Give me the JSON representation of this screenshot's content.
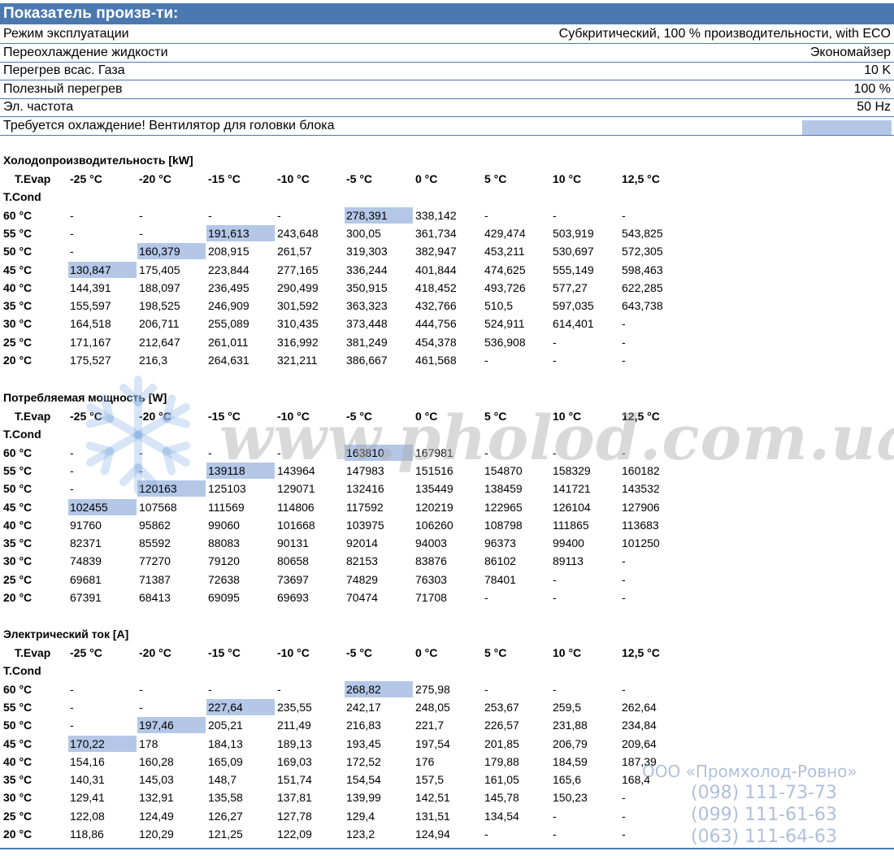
{
  "header": {
    "title": "Показатель произв-ти:"
  },
  "info_rows": [
    {
      "label": "Режим эксплуатации",
      "value": "Субкритический, 100 % производительности, with ECO"
    },
    {
      "label": "Переохлаждение жидкости",
      "value": "Экономайзер"
    },
    {
      "label": "Перегрев всас. Газа",
      "value": "10 K"
    },
    {
      "label": "Полезный перегрев",
      "value": "100 %"
    },
    {
      "label": "Эл. частота",
      "value": "50 Hz"
    },
    {
      "label": "Требуется охлаждение! Вентилятор для головки блока",
      "value": ""
    }
  ],
  "colors": {
    "header": "#4a79b0",
    "highlight": "#b4c7e7"
  },
  "tables": [
    {
      "title": "Холодопроизводительность [kW]",
      "evap_label": "T.Evap",
      "cond_label": "T.Cond",
      "columns": [
        "-25 °C",
        "-20 °C",
        "-15 °C",
        "-10 °C",
        "-5 °C",
        "0 °C",
        "5 °C",
        "10 °C",
        "12,5 °C"
      ],
      "rows": [
        {
          "cond": "60 °C",
          "cells": [
            "-",
            "-",
            "-",
            "-",
            "278,391",
            "338,142",
            "-",
            "-",
            "-"
          ],
          "highlight": 4
        },
        {
          "cond": "55 °C",
          "cells": [
            "-",
            "-",
            "191,613",
            "243,648",
            "300,05",
            "361,734",
            "429,474",
            "503,919",
            "543,825"
          ],
          "highlight": 2
        },
        {
          "cond": "50 °C",
          "cells": [
            "-",
            "160,379",
            "208,915",
            "261,57",
            "319,303",
            "382,947",
            "453,211",
            "530,697",
            "572,305"
          ],
          "highlight": 1
        },
        {
          "cond": "45 °C",
          "cells": [
            "130,847",
            "175,405",
            "223,844",
            "277,165",
            "336,244",
            "401,844",
            "474,625",
            "555,149",
            "598,463"
          ],
          "highlight": 0
        },
        {
          "cond": "40 °C",
          "cells": [
            "144,391",
            "188,097",
            "236,495",
            "290,499",
            "350,915",
            "418,452",
            "493,726",
            "577,27",
            "622,285"
          ]
        },
        {
          "cond": "35 °C",
          "cells": [
            "155,597",
            "198,525",
            "246,909",
            "301,592",
            "363,323",
            "432,766",
            "510,5",
            "597,035",
            "643,738"
          ]
        },
        {
          "cond": "30 °C",
          "cells": [
            "164,518",
            "206,711",
            "255,089",
            "310,435",
            "373,448",
            "444,756",
            "524,911",
            "614,401",
            "-"
          ]
        },
        {
          "cond": "25 °C",
          "cells": [
            "171,167",
            "212,647",
            "261,011",
            "316,992",
            "381,249",
            "454,378",
            "536,908",
            "-",
            "-"
          ]
        },
        {
          "cond": "20 °C",
          "cells": [
            "175,527",
            "216,3",
            "264,631",
            "321,211",
            "386,667",
            "461,568",
            "-",
            "-",
            "-"
          ]
        }
      ]
    },
    {
      "title": "Потребляемая мощность [W]",
      "evap_label": "T.Evap",
      "cond_label": "T.Cond",
      "columns": [
        "-25 °C",
        "-20 °C",
        "-15 °C",
        "-10 °C",
        "-5 °C",
        "0 °C",
        "5 °C",
        "10 °C",
        "12,5 °C"
      ],
      "rows": [
        {
          "cond": "60 °C",
          "cells": [
            "-",
            "-",
            "-",
            "-",
            "163810",
            "167981",
            "-",
            "-",
            "-"
          ],
          "highlight": 4
        },
        {
          "cond": "55 °C",
          "cells": [
            "-",
            "-",
            "139118",
            "143964",
            "147983",
            "151516",
            "154870",
            "158329",
            "160182"
          ],
          "highlight": 2
        },
        {
          "cond": "50 °C",
          "cells": [
            "-",
            "120163",
            "125103",
            "129071",
            "132416",
            "135449",
            "138459",
            "141721",
            "143532"
          ],
          "highlight": 1
        },
        {
          "cond": "45 °C",
          "cells": [
            "102455",
            "107568",
            "111569",
            "114806",
            "117592",
            "120219",
            "122965",
            "126104",
            "127906"
          ],
          "highlight": 0
        },
        {
          "cond": "40 °C",
          "cells": [
            "91760",
            "95862",
            "99060",
            "101668",
            "103975",
            "106260",
            "108798",
            "111865",
            "113683"
          ]
        },
        {
          "cond": "35 °C",
          "cells": [
            "82371",
            "85592",
            "88083",
            "90131",
            "92014",
            "94003",
            "96373",
            "99400",
            "101250"
          ]
        },
        {
          "cond": "30 °C",
          "cells": [
            "74839",
            "77270",
            "79120",
            "80658",
            "82153",
            "83876",
            "86102",
            "89113",
            "-"
          ]
        },
        {
          "cond": "25 °C",
          "cells": [
            "69681",
            "71387",
            "72638",
            "73697",
            "74829",
            "76303",
            "78401",
            "-",
            "-"
          ]
        },
        {
          "cond": "20 °C",
          "cells": [
            "67391",
            "68413",
            "69095",
            "69693",
            "70474",
            "71708",
            "-",
            "-",
            "-"
          ]
        }
      ]
    },
    {
      "title": "Электрический ток [A]",
      "evap_label": "T.Evap",
      "cond_label": "T.Cond",
      "columns": [
        "-25 °C",
        "-20 °C",
        "-15 °C",
        "-10 °C",
        "-5 °C",
        "0 °C",
        "5 °C",
        "10 °C",
        "12,5 °C"
      ],
      "rows": [
        {
          "cond": "60 °C",
          "cells": [
            "-",
            "-",
            "-",
            "-",
            "268,82",
            "275,98",
            "-",
            "-",
            "-"
          ],
          "highlight": 4
        },
        {
          "cond": "55 °C",
          "cells": [
            "-",
            "-",
            "227,64",
            "235,55",
            "242,17",
            "248,05",
            "253,67",
            "259,5",
            "262,64"
          ],
          "highlight": 2
        },
        {
          "cond": "50 °C",
          "cells": [
            "-",
            "197,46",
            "205,21",
            "211,49",
            "216,83",
            "221,7",
            "226,57",
            "231,88",
            "234,84"
          ],
          "highlight": 1
        },
        {
          "cond": "45 °C",
          "cells": [
            "170,22",
            "178",
            "184,13",
            "189,13",
            "193,45",
            "197,54",
            "201,85",
            "206,79",
            "209,64"
          ],
          "highlight": 0
        },
        {
          "cond": "40 °C",
          "cells": [
            "154,16",
            "160,28",
            "165,09",
            "169,03",
            "172,52",
            "176",
            "179,88",
            "184,59",
            "187,39"
          ]
        },
        {
          "cond": "35 °C",
          "cells": [
            "140,31",
            "145,03",
            "148,7",
            "151,74",
            "154,54",
            "157,5",
            "161,05",
            "165,6",
            "168,4"
          ]
        },
        {
          "cond": "30 °C",
          "cells": [
            "129,41",
            "132,91",
            "135,58",
            "137,81",
            "139,99",
            "142,51",
            "145,78",
            "150,23",
            "-"
          ]
        },
        {
          "cond": "25 °C",
          "cells": [
            "122,08",
            "124,49",
            "126,27",
            "127,78",
            "129,4",
            "131,51",
            "134,54",
            "-",
            "-"
          ]
        },
        {
          "cond": "20 °C",
          "cells": [
            "118,86",
            "120,29",
            "121,25",
            "122,09",
            "123,2",
            "124,94",
            "-",
            "-",
            "-"
          ]
        }
      ]
    }
  ],
  "watermark": {
    "site": "www.pholod.com.ua"
  },
  "company": {
    "name": "ООО «Промхолод-Ровно»",
    "phones": [
      "(098) 111-73-73",
      "(099) 111-61-63",
      "(063) 111-64-63"
    ]
  }
}
